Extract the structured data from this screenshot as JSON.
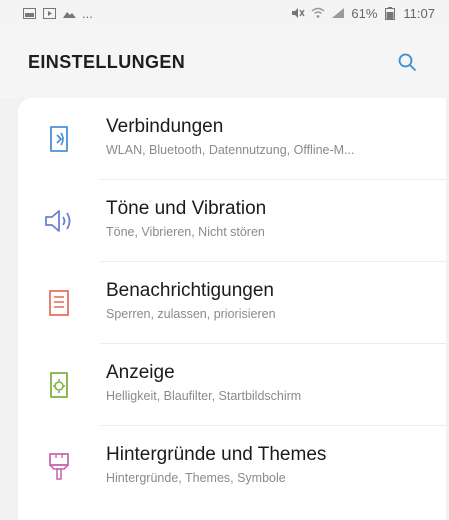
{
  "status_bar": {
    "left_icons": [
      "gallery-icon",
      "play-icon",
      "image-icon"
    ],
    "more": "...",
    "battery": "61%",
    "time": "11:07"
  },
  "header": {
    "title": "EINSTELLUNGEN",
    "search_icon": "search-icon"
  },
  "settings": [
    {
      "title": "Verbindungen",
      "subtitle": "WLAN, Bluetooth, Datennutzung, Offline-M...",
      "icon": "connections-icon",
      "color": "#4a90d9"
    },
    {
      "title": "Töne und Vibration",
      "subtitle": "Töne, Vibrieren, Nicht stören",
      "icon": "sound-icon",
      "color": "#6a7fd6"
    },
    {
      "title": "Benachrichtigungen",
      "subtitle": "Sperren, zulassen, priorisieren",
      "icon": "notifications-icon",
      "color": "#e5735f"
    },
    {
      "title": "Anzeige",
      "subtitle": "Helligkeit, Blaufilter, Startbildschirm",
      "icon": "display-icon",
      "color": "#7cb342"
    },
    {
      "title": "Hintergründe und Themes",
      "subtitle": "Hintergründe, Themes, Symbole",
      "icon": "themes-icon",
      "color": "#c76bb0"
    }
  ]
}
